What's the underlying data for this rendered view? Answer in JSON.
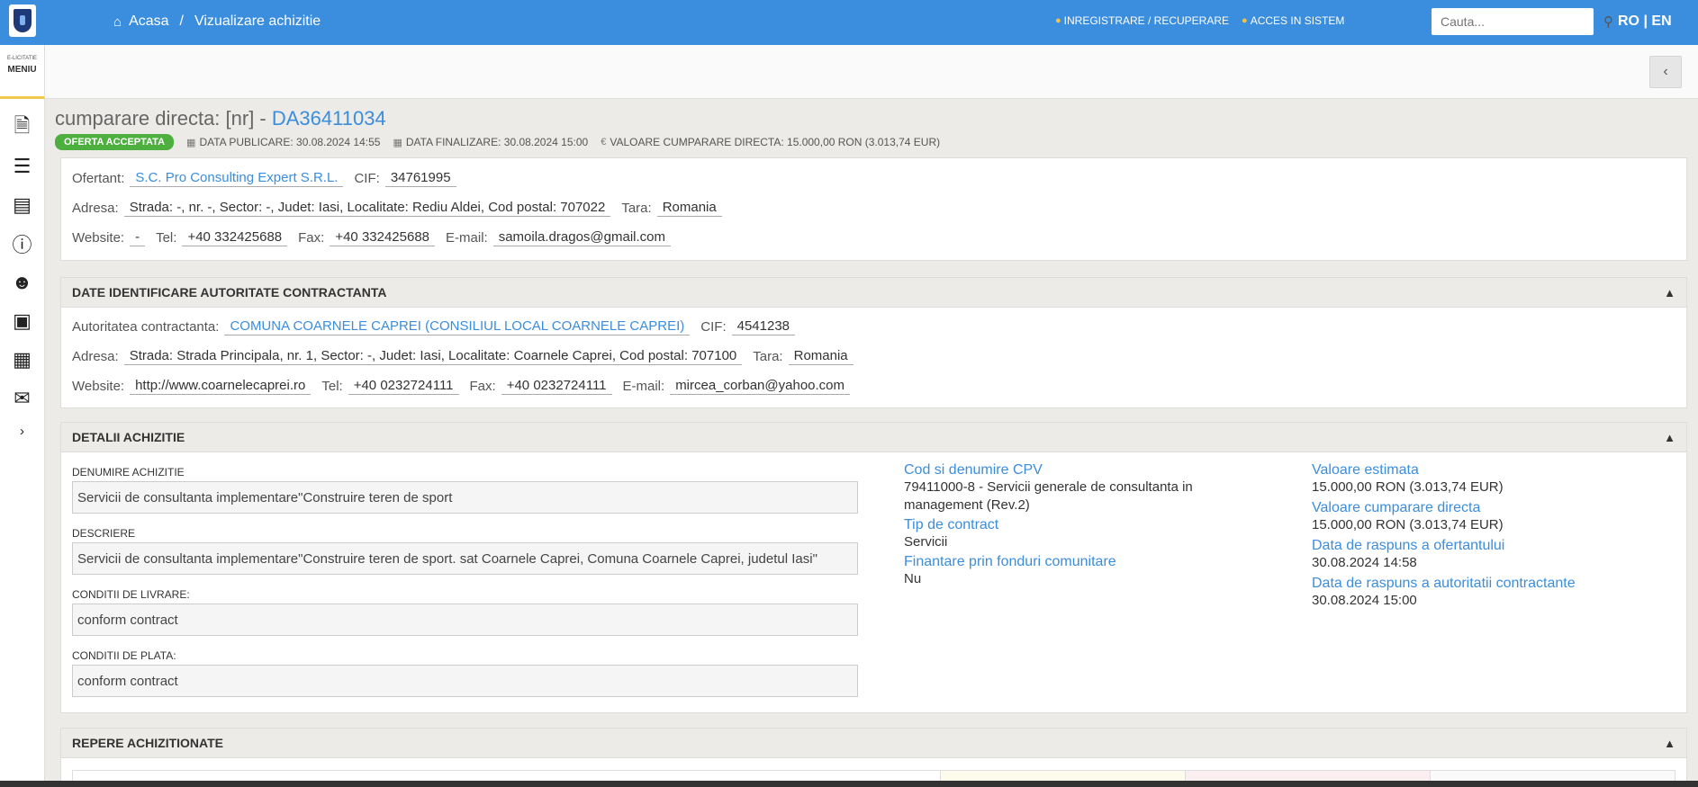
{
  "header": {
    "breadcrumb_home": "Acasa",
    "breadcrumb_sep": "/",
    "breadcrumb_current": "Vizualizare achizitie",
    "link_register": "INREGISTRARE / RECUPERARE",
    "link_login": "ACCES IN SISTEM",
    "search_placeholder": "Cauta...",
    "lang_ro": "RO",
    "lang_sep": "|",
    "lang_en": "EN"
  },
  "sidebar": {
    "sub": "E-LICITATIE",
    "menu": "MENIU"
  },
  "page": {
    "title_prefix": "cumparare directa: [nr] - ",
    "title_code": "DA36411034",
    "status_badge": "OFERTA ACCEPTATA",
    "publish_date": "DATA PUBLICARE: 30.08.2024 14:55",
    "end_date": "DATA FINALIZARE: 30.08.2024 15:00",
    "value": "VALOARE CUMPARARE DIRECTA: 15.000,00  RON (3.013,74  EUR)"
  },
  "ofertant": {
    "label_name": "Ofertant:",
    "name": "S.C. Pro Consulting Expert S.R.L.",
    "label_cif": "CIF:",
    "cif": "34761995",
    "label_address": "Adresa:",
    "address": "Strada: -, nr. -, Sector: -, Judet: Iasi, Localitate: Rediu Aldei, Cod postal: 707022",
    "label_country": "Tara:",
    "country": "Romania",
    "label_website": "Website:",
    "website": "-",
    "label_tel": "Tel:",
    "tel": "+40 332425688",
    "label_fax": "Fax:",
    "fax": "+40 332425688",
    "label_email": "E-mail:",
    "email": "samoila.dragos@gmail.com"
  },
  "autoritate": {
    "heading": "DATE IDENTIFICARE AUTORITATE CONTRACTANTA",
    "label_name": "Autoritatea contractanta:",
    "name": "COMUNA COARNELE CAPREI (CONSILIUL LOCAL COARNELE CAPREI)",
    "label_cif": "CIF:",
    "cif": "4541238",
    "label_address": "Adresa:",
    "address": "Strada: Strada Principala, nr. 1, Sector: -, Judet: Iasi, Localitate: Coarnele Caprei, Cod postal: 707100",
    "label_country": "Tara:",
    "country": "Romania",
    "label_website": "Website:",
    "website": "http://www.coarnelecaprei.ro",
    "label_tel": "Tel:",
    "tel": "+40 0232724111",
    "label_fax": "Fax:",
    "fax": "+40 0232724111",
    "label_email": "E-mail:",
    "email": "mircea_corban@yahoo.com"
  },
  "detalii": {
    "heading": "DETALII ACHIZITIE",
    "denumire_label": "DENUMIRE ACHIZITIE",
    "denumire": "Servicii de consultanta implementare\"Construire teren de sport",
    "descriere_label": "DESCRIERE",
    "descriere": "Servicii de consultanta implementare\"Construire teren de sport. sat Coarnele Caprei, Comuna Coarnele Caprei, judetul Iasi\"",
    "livrare_label": "CONDITII DE LIVRARE:",
    "livrare": "conform contract",
    "plata_label": "CONDITII DE PLATA:",
    "plata": "conform contract",
    "cpv_title": "Cod si denumire CPV",
    "cpv_value": "79411000-8 - Servicii generale de consultanta in management (Rev.2)",
    "tip_title": "Tip de contract",
    "tip_value": "Servicii",
    "fonduri_title": "Finantare prin fonduri comunitare",
    "fonduri_value": "Nu",
    "val_est_title": "Valoare estimata",
    "val_est_value": "15.000,00  RON (3.013,74  EUR)",
    "val_cd_title": "Valoare cumparare directa",
    "val_cd_value": "15.000,00  RON (3.013,74  EUR)",
    "resp_of_title": "Data de raspuns a ofertantului",
    "resp_of_value": "30.08.2024 14:58",
    "resp_aut_title": "Data de raspuns a autoritatii contractante",
    "resp_aut_value": "30.08.2024 15:00"
  },
  "repere": {
    "heading": "REPERE ACHIZITIONATE"
  }
}
